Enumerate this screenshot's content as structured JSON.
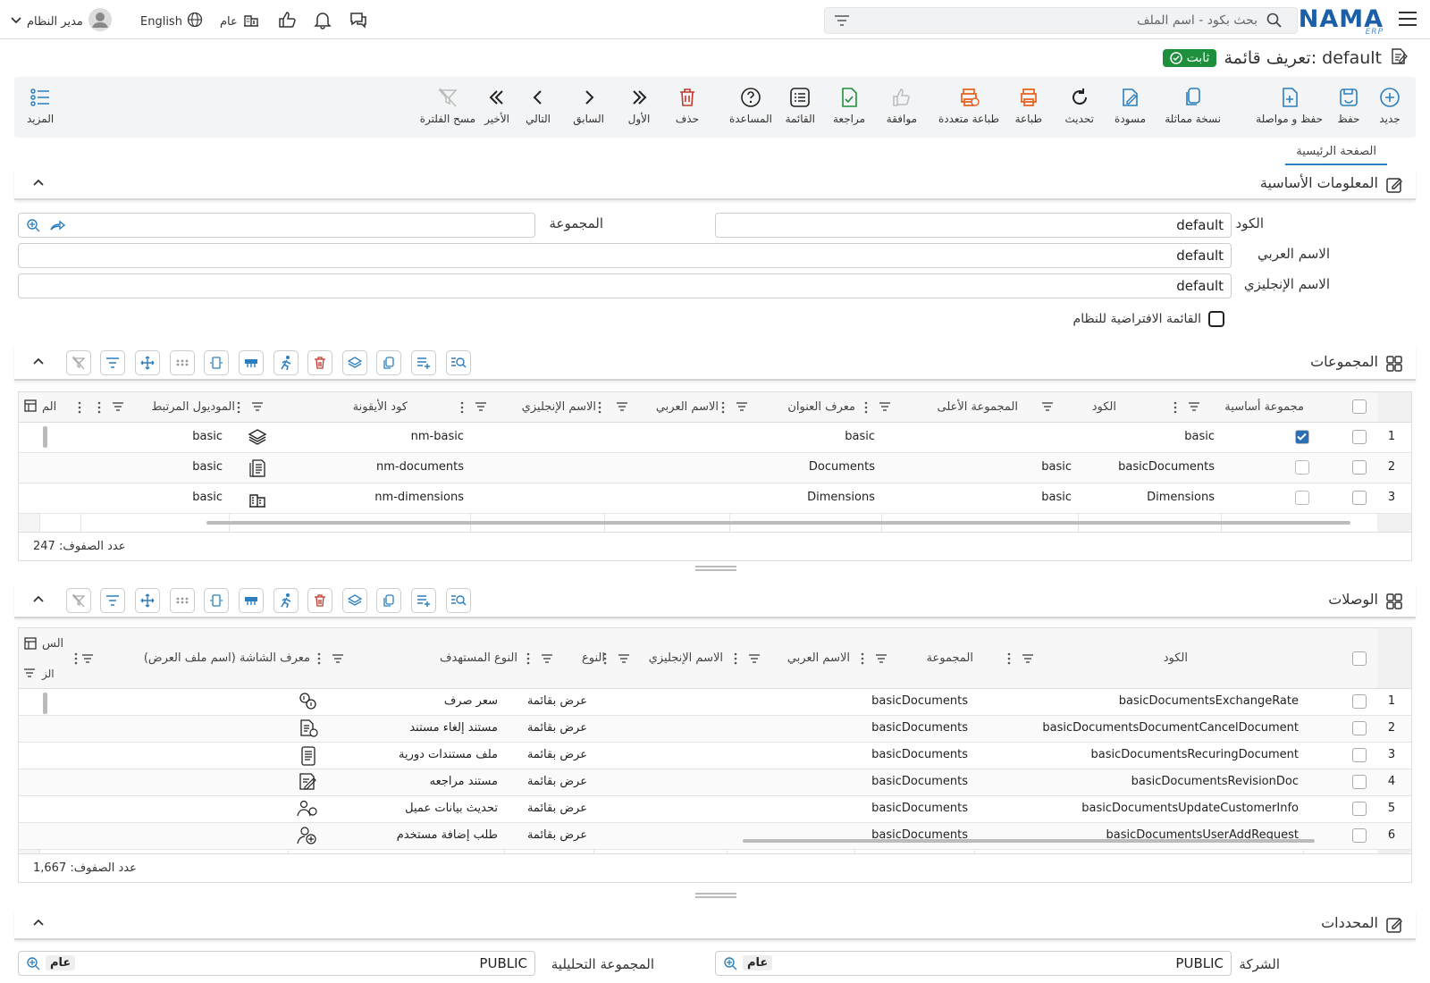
{
  "header": {
    "logo_text": "NAMA",
    "logo_sub": "ERP",
    "search_placeholder": "بحث بكود - اسم الملف",
    "user_name": "مدير النظام",
    "language": "English",
    "scope": "عام"
  },
  "page": {
    "title": "تعريف قائمة: default",
    "status_badge": "ثابت"
  },
  "toolbar": {
    "new": "جديد",
    "save": "حفظ",
    "save_continue": "حفظ و مواصلة",
    "duplicate": "نسخة مماثلة",
    "draft": "مسودة",
    "refresh": "تحديث",
    "print": "طباعة",
    "multi_print": "طباعة متعددة",
    "approve": "موافقة",
    "review": "مراجعة",
    "list": "القائمة",
    "help": "المساعدة",
    "delete": "حذف",
    "first": "الأول",
    "previous": "السابق",
    "next": "التالي",
    "last": "الأخير",
    "clear_filter": "مسح الفلترة",
    "more": "المزيد"
  },
  "tabs": {
    "main": "الصفحة الرئيسية"
  },
  "basic_info": {
    "section_title": "المعلومات الأساسية",
    "code_label": "الكود",
    "code_value": "default",
    "group_label": "المجموعة",
    "arabic_name_label": "الاسم العربي",
    "arabic_name_value": "default",
    "english_name_label": "الاسم الإنجليزي",
    "english_name_value": "default",
    "default_list_label": "القائمة الافتراضية للنظام"
  },
  "groups": {
    "section_title": "المجموعات",
    "columns": {
      "main_group": "مجموعة أساسية",
      "code": "الكود",
      "parent_group": "المجموعة الأعلى",
      "title_id": "معرف العنوان",
      "arabic_name": "الاسم العربي",
      "english_name": "الاسم الإنجليزي",
      "icon_code": "كود الأيقونة",
      "related_module": "الموديول المرتبط",
      "cut": "الم"
    },
    "rows": [
      {
        "num": "1",
        "main": true,
        "code": "basic",
        "parent": "",
        "title_id": "basic",
        "icon": "nm-basic",
        "module": "basic"
      },
      {
        "num": "2",
        "main": false,
        "code": "basicDocuments",
        "parent": "basic",
        "title_id": "Documents",
        "icon": "nm-documents",
        "module": "basic"
      },
      {
        "num": "3",
        "main": false,
        "code": "Dimensions",
        "parent": "basic",
        "title_id": "Dimensions",
        "icon": "nm-dimensions",
        "module": "basic"
      }
    ],
    "row_count": "عدد الصفوف: 247"
  },
  "links": {
    "section_title": "الوصلات",
    "columns": {
      "code": "الكود",
      "group": "المجموعة",
      "arabic_name": "الاسم العربي",
      "english_name": "الاسم الإنجليزي",
      "type": "النوع",
      "target_type": "النوع المستهدف",
      "screen_id": "معرف الشاشة (اسم ملف العرض)",
      "cut1": "الس",
      "cut2": "الز"
    },
    "rows": [
      {
        "num": "1",
        "code": "basicDocumentsExchangeRate",
        "group": "basicDocuments",
        "type": "عرض بقائمة",
        "target": "سعر صرف"
      },
      {
        "num": "2",
        "code": "basicDocumentsDocumentCancelDocument",
        "group": "basicDocuments",
        "type": "عرض بقائمة",
        "target": "مستند إلغاء مستند"
      },
      {
        "num": "3",
        "code": "basicDocumentsRecuringDocument",
        "group": "basicDocuments",
        "type": "عرض بقائمة",
        "target": "ملف مستندات دورية"
      },
      {
        "num": "4",
        "code": "basicDocumentsRevisionDoc",
        "group": "basicDocuments",
        "type": "عرض بقائمة",
        "target": "مستند مراجعه"
      },
      {
        "num": "5",
        "code": "basicDocumentsUpdateCustomerInfo",
        "group": "basicDocuments",
        "type": "عرض بقائمة",
        "target": "تحديث بيانات عميل"
      },
      {
        "num": "6",
        "code": "basicDocumentsUserAddRequest",
        "group": "basicDocuments",
        "type": "عرض بقائمة",
        "target": "طلب إضافة مستخدم"
      }
    ],
    "row_count": "عدد الصفوف: 1,667"
  },
  "selectors": {
    "section_title": "المحددات",
    "company_label": "الشركة",
    "company_value": "PUBLIC",
    "company_chip": "عام",
    "analytic_group_label": "المجموعة التحليلية",
    "analytic_group_value": "PUBLIC",
    "analytic_chip": "عام"
  },
  "colors": {
    "accent": "#2b7fc0",
    "badge": "#1e8f3d",
    "print": "#e8601c",
    "delete": "#c0392b"
  }
}
